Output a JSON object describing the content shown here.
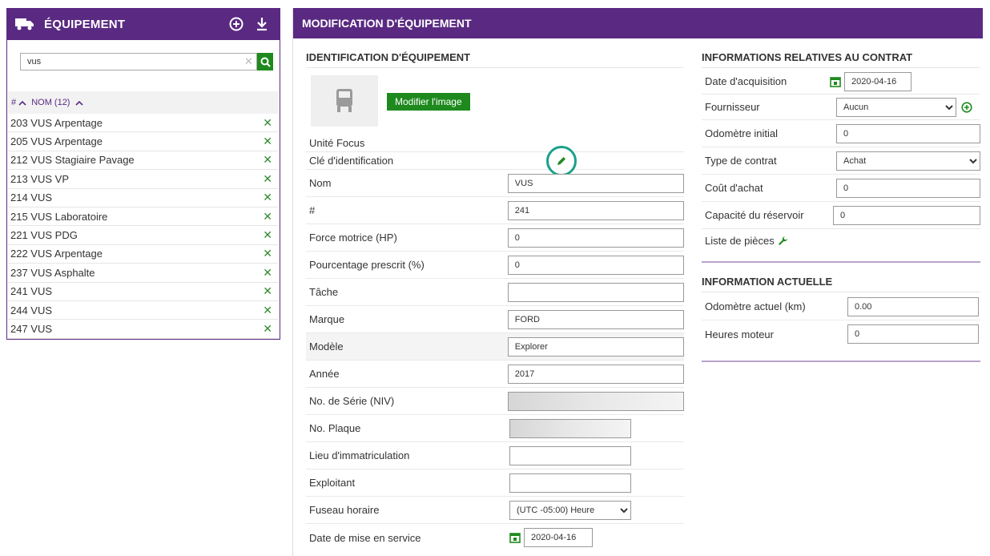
{
  "left": {
    "title": "ÉQUIPEMENT",
    "search_value": "vus",
    "header_hash": "#",
    "header_name": "NOM (12)",
    "items": [
      "203 VUS Arpentage",
      "205 VUS Arpentage",
      "212 VUS Stagiaire Pavage",
      "213 VUS VP",
      "214 VUS",
      "215 VUS Laboratoire",
      "221 VUS PDG",
      "222 VUS Arpentage",
      "237 VUS Asphalte",
      "241 VUS",
      "244 VUS",
      "247 VUS"
    ]
  },
  "main": {
    "title": "MODIFICATION D'ÉQUIPEMENT",
    "ident": {
      "title": "IDENTIFICATION D'ÉQUIPEMENT",
      "modify_image": "Modifier l'image",
      "unit_label": "Unité Focus",
      "key_label": "Clé d'identification",
      "fields": {
        "nom": {
          "label": "Nom",
          "value": "VUS"
        },
        "num": {
          "label": "#",
          "value": "241"
        },
        "force": {
          "label": "Force motrice (HP)",
          "value": "0"
        },
        "pourcentage": {
          "label": "Pourcentage prescrit (%)",
          "value": "0"
        },
        "tache": {
          "label": "Tâche",
          "value": ""
        },
        "marque": {
          "label": "Marque",
          "value": "FORD"
        },
        "modele": {
          "label": "Modèle",
          "value": "Explorer"
        },
        "annee": {
          "label": "Année",
          "value": "2017"
        },
        "serie": {
          "label": "No. de Série (NIV)",
          "value": ""
        },
        "plaque": {
          "label": "No. Plaque",
          "value": ""
        },
        "lieu": {
          "label": "Lieu d'immatriculation",
          "value": ""
        },
        "exploitant": {
          "label": "Exploitant",
          "value": ""
        },
        "fuseau": {
          "label": "Fuseau horaire",
          "value": "(UTC -05:00) Heure"
        },
        "date_service": {
          "label": "Date de mise en service",
          "value": "2020-04-16"
        }
      }
    },
    "contract": {
      "title": "INFORMATIONS RELATIVES AU CONTRAT",
      "fields": {
        "acquisition": {
          "label": "Date d'acquisition",
          "value": "2020-04-16"
        },
        "fournisseur": {
          "label": "Fournisseur",
          "value": "Aucun"
        },
        "odometre_initial": {
          "label": "Odomètre initial",
          "value": "0"
        },
        "type_contrat": {
          "label": "Type de contrat",
          "value": "Achat"
        },
        "cout": {
          "label": "Coût d'achat",
          "value": "0"
        },
        "capacite": {
          "label": "Capacité du réservoir",
          "value": "0"
        },
        "pieces": {
          "label": "Liste de pièces"
        }
      }
    },
    "current": {
      "title": "INFORMATION ACTUELLE",
      "fields": {
        "odometre_actuel": {
          "label": "Odomètre actuel  (km)",
          "value": "0.00"
        },
        "heures": {
          "label": "Heures moteur",
          "value": "0"
        }
      }
    }
  },
  "colors": {
    "brand": "#5a2a82",
    "action_green": "#1e8a1e",
    "highlight_teal": "#1aa08a"
  }
}
